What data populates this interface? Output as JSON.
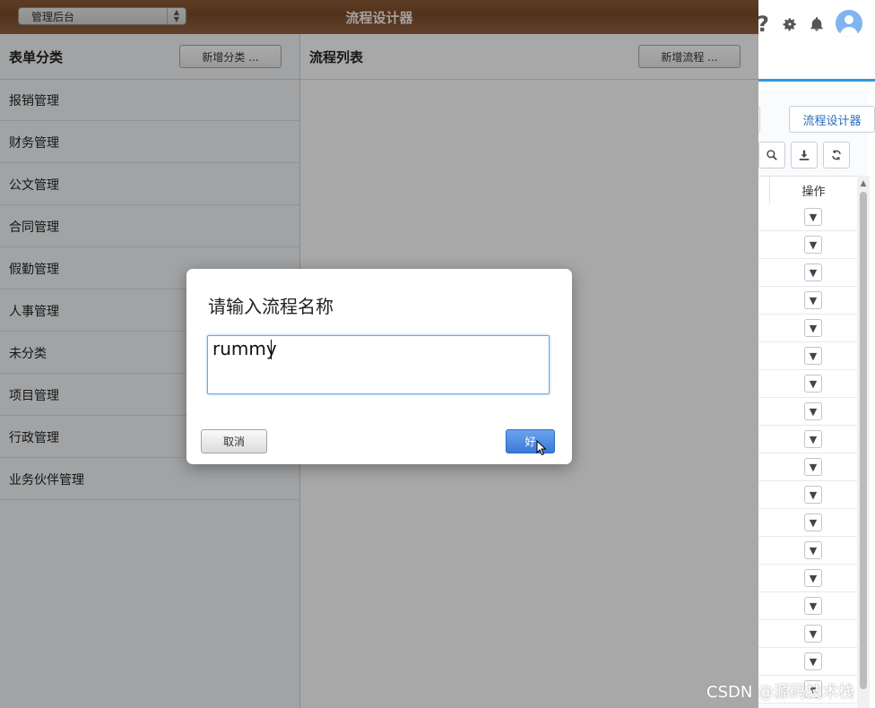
{
  "window": {
    "title": "流程设计器",
    "app_select": "管理后台"
  },
  "left_panel": {
    "heading": "表单分类",
    "add_button": "新增分类 ...",
    "categories": [
      "报销管理",
      "财务管理",
      "公文管理",
      "合同管理",
      "假勤管理",
      "人事管理",
      "未分类",
      "项目管理",
      "行政管理",
      "业务伙伴管理"
    ]
  },
  "right_panel": {
    "heading": "流程列表",
    "add_button": "新增流程 ..."
  },
  "dialog": {
    "title": "请输入流程名称",
    "input_value": "rummy",
    "cancel_label": "取消",
    "ok_label": "好"
  },
  "background_app": {
    "designer_button": "流程设计器",
    "table_header_operation": "操作",
    "icons": [
      "help-icon",
      "gear-icon",
      "bell-icon",
      "user-avatar-icon",
      "search-icon",
      "download-icon",
      "refresh-icon"
    ]
  },
  "watermark": "CSDN @源码技术栈"
}
